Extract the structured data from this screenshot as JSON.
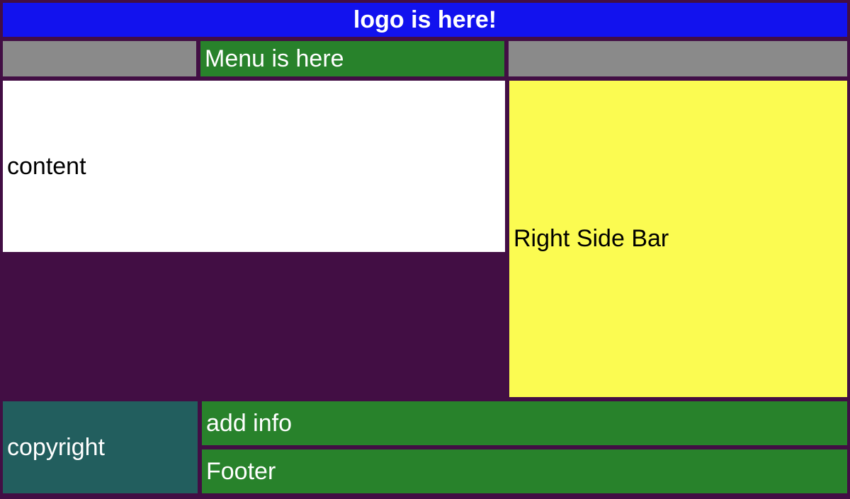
{
  "header": {
    "logo_text": "logo is here!"
  },
  "menu": {
    "label": "Menu is here"
  },
  "main": {
    "content_label": "content",
    "sidebar_label": "Right Side Bar"
  },
  "footer": {
    "copyright_label": "copyright",
    "addinfo_label": "add info",
    "footer_label": "Footer"
  },
  "colors": {
    "background": "#420e44",
    "header_bg": "#1212ee",
    "menu_side_bg": "#8a8a8a",
    "menu_center_bg": "#28822b",
    "content_bg": "#ffffff",
    "sidebar_bg": "#fbfb51",
    "copyright_bg": "#225e5e",
    "footer_bg": "#28822b"
  }
}
